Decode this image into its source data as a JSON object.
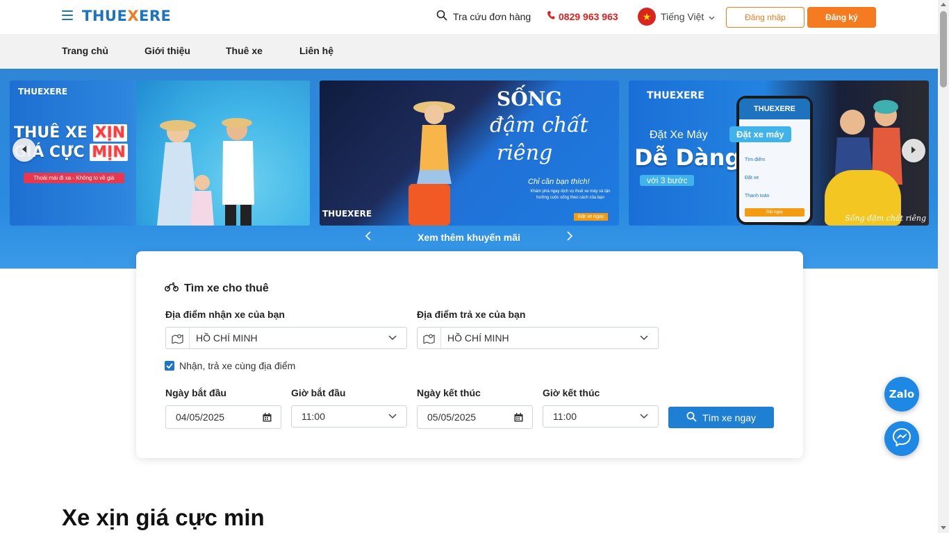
{
  "header": {
    "logo_prefix": "THUE",
    "logo_x": "X",
    "logo_suffix": "ERE",
    "lookup_label": "Tra cứu đơn hàng",
    "phone": "0829 963 963",
    "language": "Tiếng Việt",
    "login_label": "Đăng nhập",
    "register_label": "Đăng ký"
  },
  "nav": {
    "items": [
      "Trang chủ",
      "Giới thiệu",
      "Thuê xe",
      "Liên hệ"
    ]
  },
  "banners": {
    "slide1": {
      "brand": "THUEXERE",
      "headline_1a": "THUÊ XE ",
      "headline_1b": "XỊN",
      "headline_2a": "GIÁ CỰC ",
      "headline_2b": "MỊN",
      "tagline": "Thoải mái đi xa - Không lo về giá"
    },
    "slide2": {
      "title": "SỐNG",
      "subtitle_1": "đậm chất",
      "subtitle_2": "riêng",
      "small": "Chỉ cần bạn thích!",
      "tiny": "Khám phá ngay dịch vụ thuê xe máy và tận hưởng cuộc sống theo cách của bạn",
      "button": "Đặt xe ngay",
      "brand": "THUEXERE"
    },
    "slide3": {
      "brand": "THUEXERE",
      "line1": "Đặt Xe Máy",
      "line2": "Dễ Dàng",
      "pill": "với 3 bước",
      "phone_brand": "THUEXERE",
      "order_button": "Đặt xe máy",
      "steps": [
        "Tìm điểm",
        "Đặt xe",
        "Thanh toán"
      ],
      "phone_btn": "Đặt ngay",
      "signature": "Sống đậm chất riêng"
    },
    "promo_text": "Xem thêm khuyến mãi"
  },
  "search": {
    "title": "Tìm xe cho thuê",
    "pickup_label": "Địa điểm nhận xe của bạn",
    "pickup_value": "HỒ CHÍ MINH",
    "dropoff_label": "Địa điểm trả xe của bạn",
    "dropoff_value": "HỒ CHÍ MINH",
    "same_location_label": "Nhận, trả xe cùng địa điểm",
    "same_location_checked": true,
    "start_date_label": "Ngày bắt đầu",
    "start_date_value": "04/05/2025",
    "start_time_label": "Giờ bắt đầu",
    "start_time_value": "11:00",
    "end_date_label": "Ngày kết thúc",
    "end_date_value": "05/05/2025",
    "end_time_label": "Giờ kết thúc",
    "end_time_value": "11:00",
    "submit_label": "Tìm xe ngay"
  },
  "section": {
    "heading": "Xe xịn giá cực min"
  },
  "floating": {
    "zalo_label": "Zalo"
  },
  "colors": {
    "brand_blue": "#1e73be",
    "brand_orange": "#f47b20",
    "phone_red": "#e02020",
    "hero_blue": "#2a8be0"
  }
}
